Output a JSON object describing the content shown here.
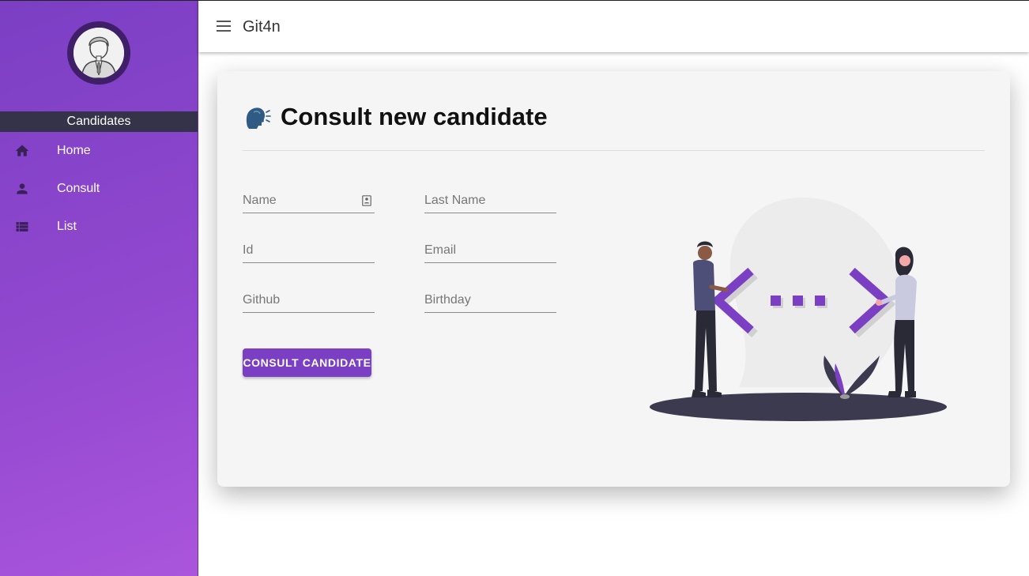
{
  "app": {
    "title": "Git4n"
  },
  "sidebar": {
    "section_label": "Candidates",
    "items": [
      {
        "label": "Home",
        "icon": "home-icon"
      },
      {
        "label": "Consult",
        "icon": "person-icon"
      },
      {
        "label": "List",
        "icon": "list-icon"
      }
    ]
  },
  "main": {
    "title": "Consult new candidate",
    "title_icon": "speaking-head-icon",
    "form": {
      "name_placeholder": "Name",
      "last_name_placeholder": "Last Name",
      "id_placeholder": "Id",
      "email_placeholder": "Email",
      "github_placeholder": "Github",
      "birthday_placeholder": "Birthday",
      "submit_label": "CONSULT CANDIDATE"
    }
  },
  "colors": {
    "accent": "#7b3fc4",
    "sidebar_gradient_start": "#7b3fc4",
    "sidebar_gradient_end": "#aa55dc",
    "section_label_bg": "#34334a"
  }
}
